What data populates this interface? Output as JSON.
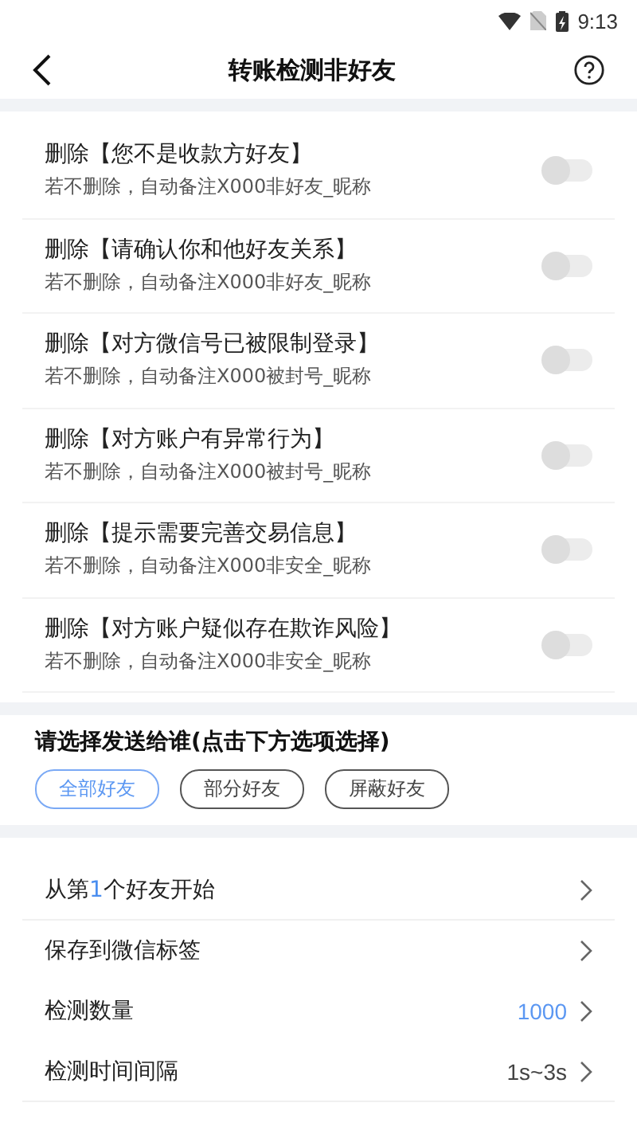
{
  "status_bar": {
    "time": "9:13"
  },
  "header": {
    "title": "转账检测非好友"
  },
  "options": [
    {
      "title": "删除【您不是收款方好友】",
      "subtitle": "若不删除，自动备注X000非好友_昵称",
      "on": false
    },
    {
      "title": "删除【请确认你和他好友关系】",
      "subtitle": "若不删除，自动备注X000非好友_昵称",
      "on": false
    },
    {
      "title": "删除【对方微信号已被限制登录】",
      "subtitle": "若不删除，自动备注X000被封号_昵称",
      "on": false
    },
    {
      "title": "删除【对方账户有异常行为】",
      "subtitle": "若不删除，自动备注X000被封号_昵称",
      "on": false
    },
    {
      "title": "删除【提示需要完善交易信息】",
      "subtitle": "若不删除，自动备注X000非安全_昵称",
      "on": false
    },
    {
      "title": "删除【对方账户疑似存在欺诈风险】",
      "subtitle": "若不删除，自动备注X000非安全_昵称",
      "on": false
    }
  ],
  "recipients": {
    "title": "请选择发送给谁(点击下方选项选择)",
    "choices": [
      {
        "label": "全部好友",
        "selected": true
      },
      {
        "label": "部分好友",
        "selected": false
      },
      {
        "label": "屏蔽好友",
        "selected": false
      }
    ]
  },
  "settings": [
    {
      "label": "从第**1**个好友开始",
      "divider": true
    },
    {
      "label": "保存到微信标签",
      "divider": false
    },
    {
      "label": "检测数量",
      "value": "1000",
      "highlight": true,
      "divider": false
    },
    {
      "label": "检测时间间隔",
      "value": "1s~3s",
      "highlight": false,
      "divider": true
    }
  ]
}
